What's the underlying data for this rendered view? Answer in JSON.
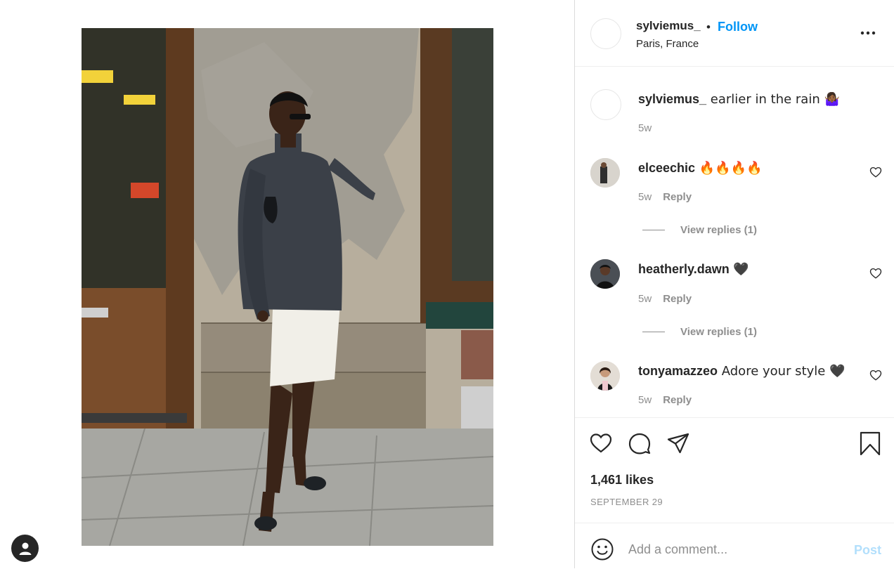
{
  "post": {
    "author": "sylviemus_",
    "follow_label": "Follow",
    "separator": "•",
    "location": "Paris, France",
    "more_icon": "more-options-icon",
    "photo_alt": "Woman in grey turtleneck sweater and white skirt standing against stone wall"
  },
  "caption": {
    "username": "sylviemus_",
    "text": " earlier in the rain 🤷🏾‍♀️",
    "time": "5w"
  },
  "comments": [
    {
      "username": "elceechic",
      "text": " 🔥🔥🔥🔥",
      "time": "5w",
      "reply_label": "Reply",
      "view_replies": "View replies (1)"
    },
    {
      "username": "heatherly.dawn",
      "text": " 🖤",
      "time": "5w",
      "reply_label": "Reply",
      "view_replies": "View replies (1)"
    },
    {
      "username": "tonyamazzeo",
      "text": " Adore your style 🖤",
      "time": "5w",
      "reply_label": "Reply"
    }
  ],
  "actions": {
    "icons": [
      "heart-icon",
      "comment-icon",
      "share-icon",
      "bookmark-icon"
    ],
    "likes": "1,461 likes",
    "date": "SEPTEMBER 29"
  },
  "add_comment": {
    "placeholder": "Add a comment...",
    "post_label": "Post",
    "post_color": "#b2dffc"
  },
  "colors": {
    "accent": "#0095f6",
    "text": "#262626",
    "muted": "#8e8e8e",
    "border": "#dbdbdb"
  }
}
